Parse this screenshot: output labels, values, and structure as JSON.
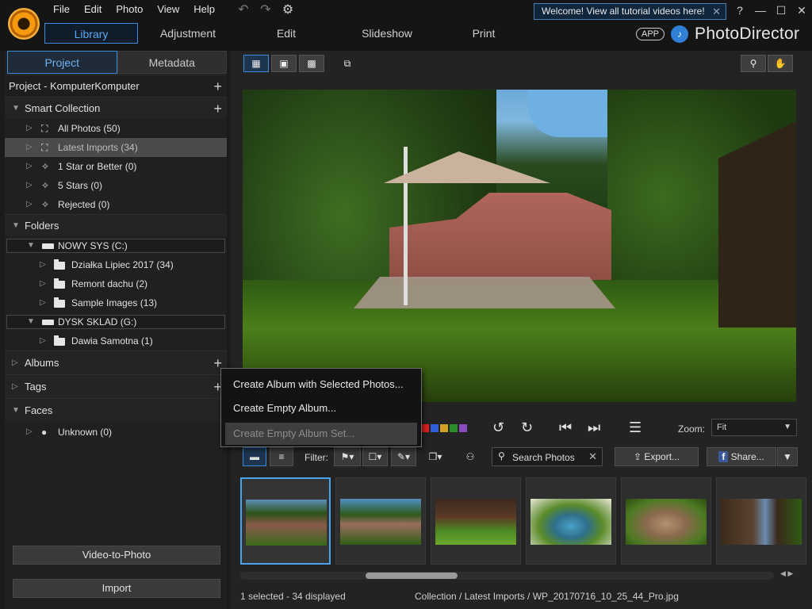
{
  "menu": [
    "File",
    "Edit",
    "Photo",
    "View",
    "Help"
  ],
  "welcome": "Welcome! View all tutorial videos here!",
  "window_controls": {
    "help": "?",
    "minimize": "—",
    "maximize": "☐",
    "close": "✕"
  },
  "modes": [
    {
      "label": "Library",
      "active": true
    },
    {
      "label": "Adjustment",
      "active": false
    },
    {
      "label": "Edit",
      "active": false
    },
    {
      "label": "Slideshow",
      "active": false
    },
    {
      "label": "Print",
      "active": false
    }
  ],
  "brand": {
    "app_badge": "APP",
    "name": "PhotoDirector"
  },
  "left": {
    "tabs": [
      "Project",
      "Metadata"
    ],
    "project": "Project - KomputerKomputer",
    "smart_collection": {
      "title": "Smart Collection",
      "items": [
        "All Photos (50)",
        "Latest Imports (34)",
        "1 Star or Better (0)",
        "5 Stars (0)",
        "Rejected (0)"
      ]
    },
    "folders": {
      "title": "Folders",
      "drive1": "NOWY SYS (C:)",
      "drive1_items": [
        "Działka Lipiec 2017 (34)",
        "Remont dachu (2)",
        "Sample Images (13)"
      ],
      "drive2": "DYSK SKLAD (G:)",
      "drive2_items": [
        "Dawia Samotna (1)"
      ]
    },
    "albums": "Albums",
    "tags": "Tags",
    "faces": {
      "title": "Faces",
      "items": [
        "Unknown (0)"
      ]
    },
    "buttons": {
      "video_to_photo": "Video-to-Photo",
      "import": "Import"
    }
  },
  "controls": {
    "zoom_label": "Zoom:",
    "zoom_value": "Fit",
    "label_colors": [
      "#e02020",
      "#2f5fd8",
      "#d4a020",
      "#2a8f2a",
      "#8a4ac0"
    ]
  },
  "filter_bar": {
    "filter_label": "Filter:",
    "search_placeholder": "Search Photos",
    "export": "Export...",
    "share": "Share..."
  },
  "context_menu": [
    "Create Album with Selected Photos...",
    "Create Empty Album...",
    "Create Empty Album Set..."
  ],
  "status": {
    "left": "1 selected - 34 displayed",
    "right": "Collection / Latest Imports / WP_20170716_10_25_44_Pro.jpg"
  }
}
